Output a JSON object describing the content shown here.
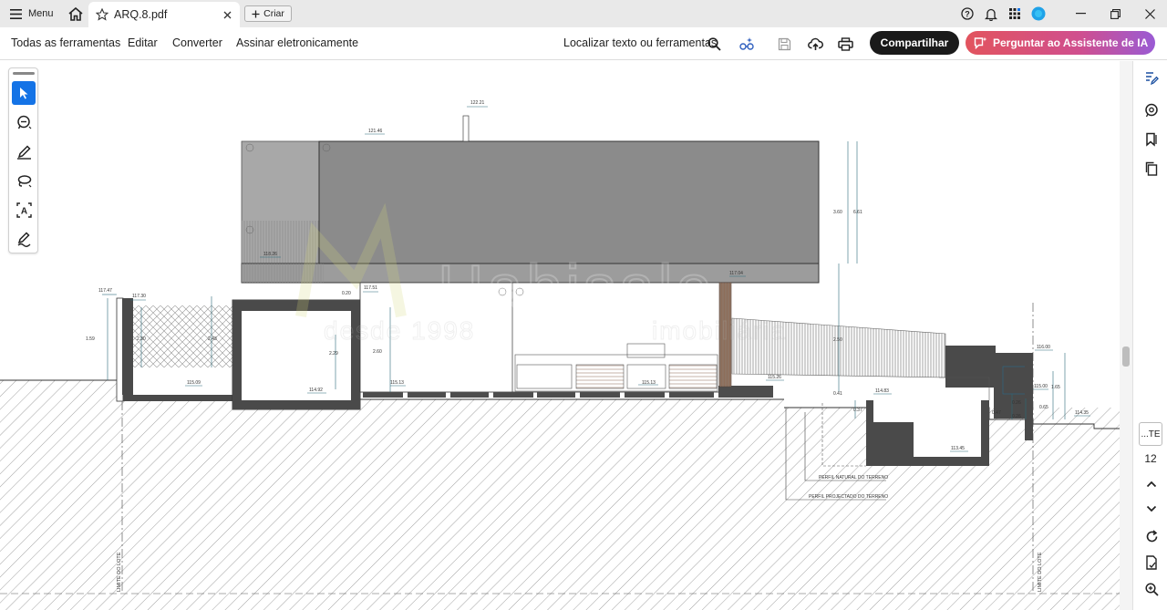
{
  "titlebar": {
    "menu_label": "Menu",
    "tab_title": "ARQ.8.pdf",
    "new_label": "Criar"
  },
  "toolbar": {
    "all_tools": "Todas as ferramentas",
    "edit": "Editar",
    "convert": "Converter",
    "sign": "Assinar eletronicamente",
    "search_text": "Localizar texto ou ferramentas",
    "share": "Compartilhar",
    "ai_assistant": "Perguntar ao Assistente de IA"
  },
  "page_nav": {
    "page_label": "...TE",
    "page_count": "12"
  },
  "drawing": {
    "watermark_brand": "Habisale",
    "watermark_since": "desde 1998",
    "watermark_sub": "imobiliária",
    "levels": {
      "roof_top": "122.21",
      "roof_upper": "121.46",
      "terrace": "118.26",
      "left_wall": "117.47",
      "mid_left": "117.30",
      "mid_right": "117.51",
      "brown_post": "117.04",
      "floor_main": "115.13",
      "floor_left": "115.09",
      "basement_left": "114.92",
      "terrace_right": "115.26",
      "step_right": "114.83",
      "pool_bottom": "113.45",
      "right_upper": "116.00",
      "right_mid": "115.00",
      "right_low": "114.35"
    },
    "dimensions": {
      "d1": "1.59",
      "d2": "2.30",
      "d3": "2.43",
      "d4": "2.29",
      "d5": "2.60",
      "d6": "0.20",
      "d7": "3.60",
      "d8": "6.61",
      "d9": "2.50",
      "d10": "0.41",
      "d11": "0.37",
      "d12": "1.65",
      "d13": "0.65",
      "d14": "0.26",
      "d15": "0.26",
      "d16": "0.47"
    },
    "labels": {
      "natural_profile": "PERFIL NATURAL DO TERRENO",
      "projected_profile": "PERFIL PROJECTADO DO TERRENO",
      "lot_limit_left": "LIMITE DO LOTE",
      "lot_limit_right": "LIMITE DO LOTE"
    }
  },
  "colors": {
    "accent_blue": "#1473e6",
    "share_bg": "#1a1a1a",
    "ai_gradient_start": "#e2545e",
    "ai_gradient_end": "#9a5bd4"
  }
}
